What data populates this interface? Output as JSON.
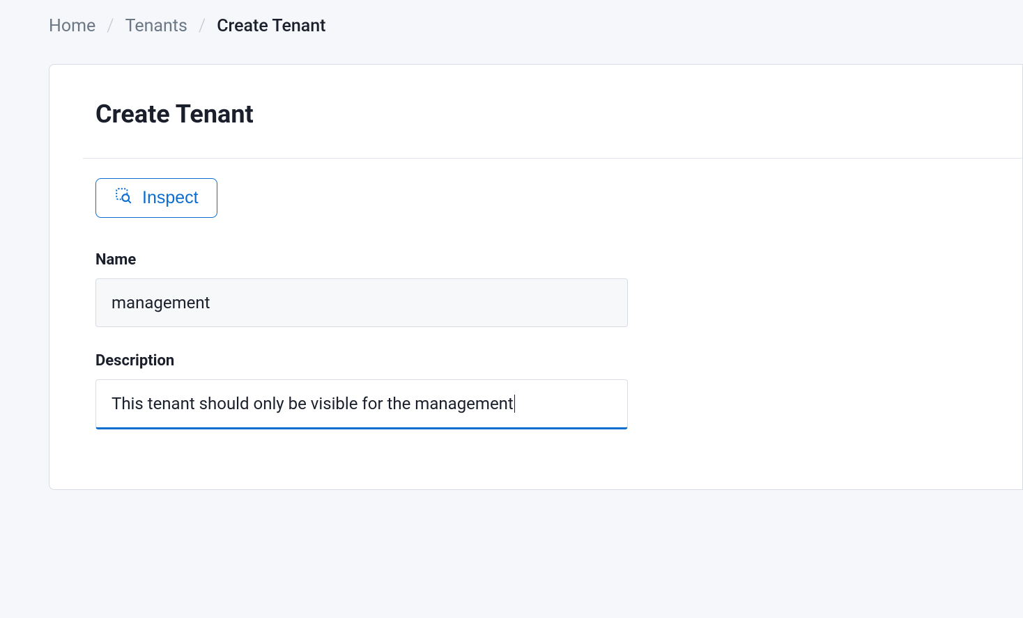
{
  "breadcrumb": {
    "home": "Home",
    "tenants": "Tenants",
    "current": "Create Tenant"
  },
  "page": {
    "title": "Create Tenant"
  },
  "actions": {
    "inspect_label": "Inspect"
  },
  "form": {
    "name": {
      "label": "Name",
      "value": "management"
    },
    "description": {
      "label": "Description",
      "value": "This tenant should only be visible for the management"
    }
  },
  "colors": {
    "accent": "#0a6ed1",
    "text": "#1a1f2b",
    "muted": "#6b7785",
    "border": "#d8dde4",
    "bg": "#f5f7fa"
  }
}
